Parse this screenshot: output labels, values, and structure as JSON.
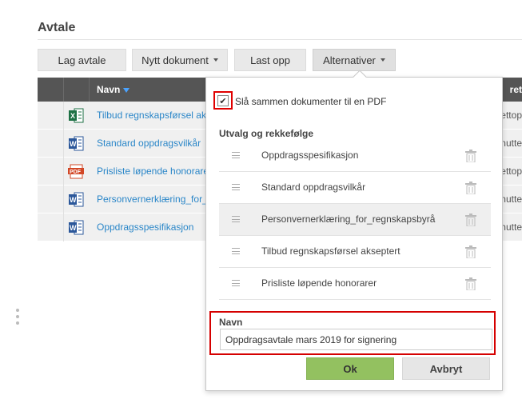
{
  "section": {
    "title": "Avtale"
  },
  "toolbar": {
    "create_label": "Lag avtale",
    "new_doc_label": "Nytt dokument",
    "upload_label": "Last opp",
    "options_label": "Alternativer"
  },
  "table": {
    "header_name": "Navn",
    "header_right": "ret",
    "rows": [
      {
        "name": "Tilbud regnskapsførsel ak",
        "icon": "excel-icon",
        "right": "ettop"
      },
      {
        "name": "Standard oppdragsvilkår",
        "icon": "word-icon",
        "right": "nutte"
      },
      {
        "name": "Prisliste løpende honorarer",
        "icon": "pdf-icon",
        "right": "ettop"
      },
      {
        "name": "Personvernerklæring_for_",
        "icon": "word-icon",
        "right": "nutte"
      },
      {
        "name": "Oppdragsspesifikasjon",
        "icon": "word-icon",
        "right": "nutte"
      }
    ]
  },
  "popup": {
    "merge_label": "Slå sammen dokumenter til en PDF",
    "merge_checked": true,
    "order_title": "Utvalg og rekkefølge",
    "docs": [
      {
        "name": "Oppdragsspesifikasjon"
      },
      {
        "name": "Standard oppdragsvilkår"
      },
      {
        "name": "Personvernerklæring_for_regnskapsbyrå"
      },
      {
        "name": "Tilbud regnskapsførsel akseptert"
      },
      {
        "name": "Prisliste løpende honorarer"
      }
    ],
    "name_label": "Navn",
    "name_value": "Oppdragsavtale mars 2019 for signering",
    "ok_label": "Ok",
    "cancel_label": "Avbryt"
  },
  "colors": {
    "accent": "#2a86c8",
    "ok_green": "#93c160",
    "highlight_red": "#e00000",
    "header_bg": "#555555"
  }
}
